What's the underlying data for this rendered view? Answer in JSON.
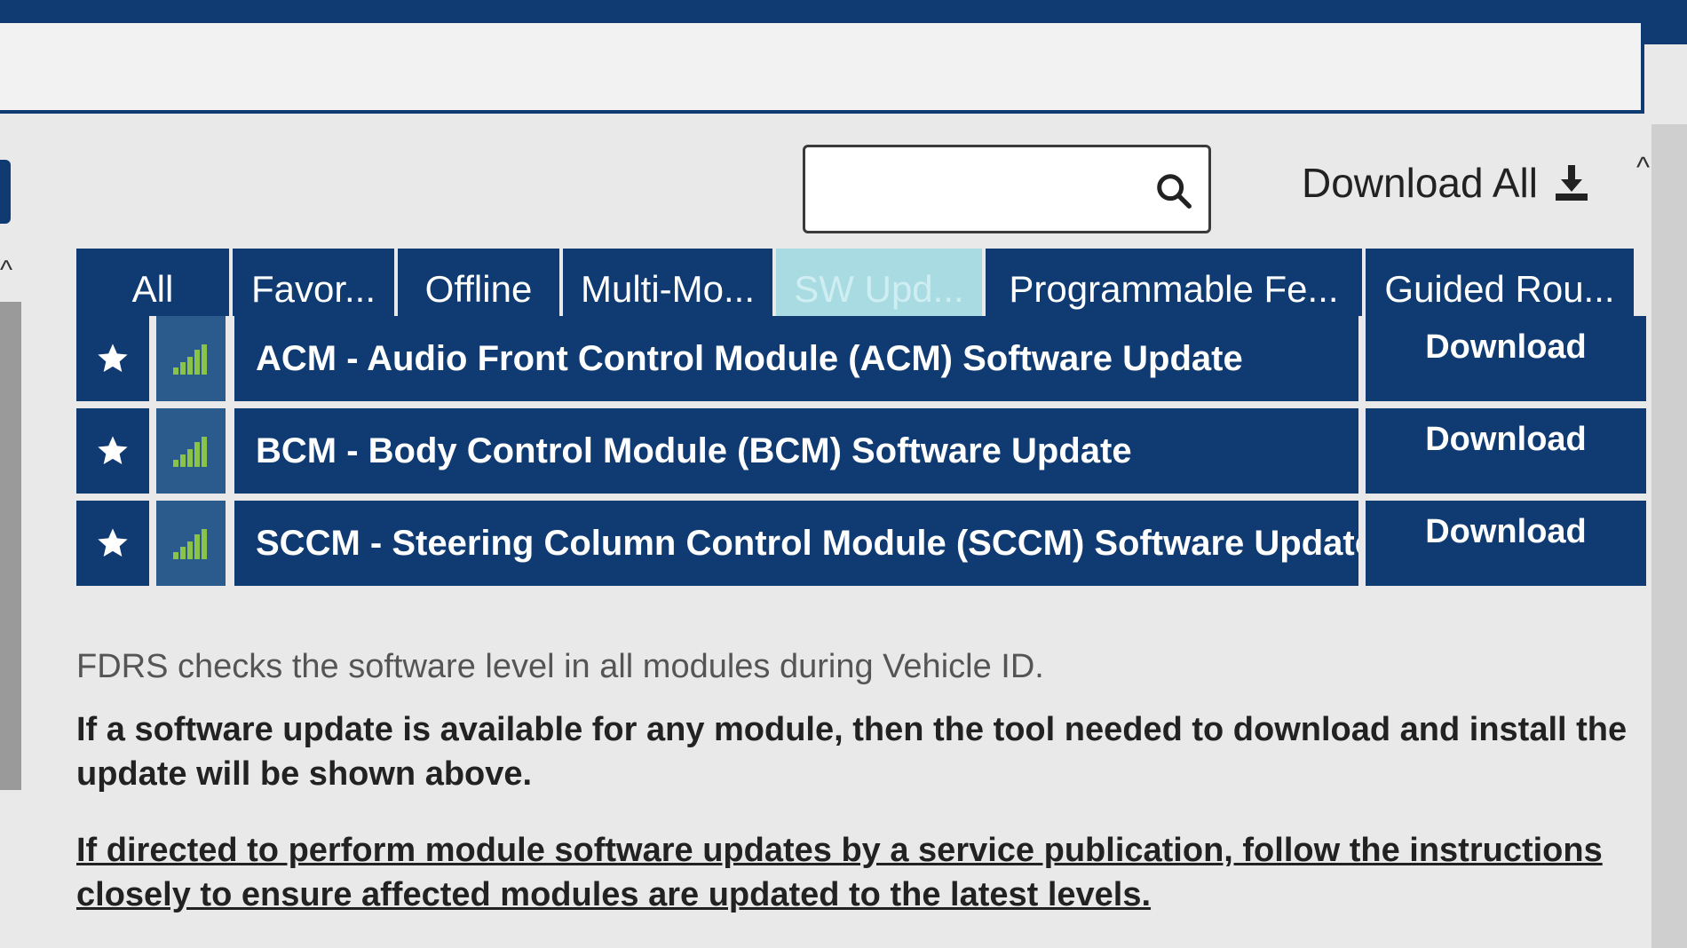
{
  "search": {
    "value": "",
    "placeholder": ""
  },
  "toolbar": {
    "download_all_label": "Download All"
  },
  "tabs": [
    {
      "label": "All",
      "active": false
    },
    {
      "label": "Favor...",
      "active": false
    },
    {
      "label": "Offline",
      "active": false
    },
    {
      "label": "Multi-Mo...",
      "active": false
    },
    {
      "label": "SW Upd...",
      "active": true
    },
    {
      "label": "Programmable Fe...",
      "active": false
    },
    {
      "label": "Guided Rou...",
      "active": false
    }
  ],
  "rows": [
    {
      "title": "ACM - Audio Front Control Module (ACM) Software Update",
      "action": "Download"
    },
    {
      "title": "BCM - Body Control Module (BCM) Software Update",
      "action": "Download"
    },
    {
      "title": "SCCM - Steering Column Control Module (SCCM) Software Update",
      "action": "Download"
    }
  ],
  "info": {
    "line1": "FDRS checks the software level in all modules during Vehicle ID.",
    "line2": "If a software update is available for any module, then the tool needed to download and install the update will be shown above.",
    "line3": "If directed to perform module software updates by a service publication, follow the instructions closely to ensure affected modules are updated to the latest levels."
  },
  "colors": {
    "primary": "#0f3a72",
    "active_tab": "#a9dbe2",
    "signal": "#8bc34a"
  },
  "icons": {
    "search": "search-icon",
    "download": "download-icon",
    "star": "star-icon",
    "signal": "signal-bars-icon"
  }
}
